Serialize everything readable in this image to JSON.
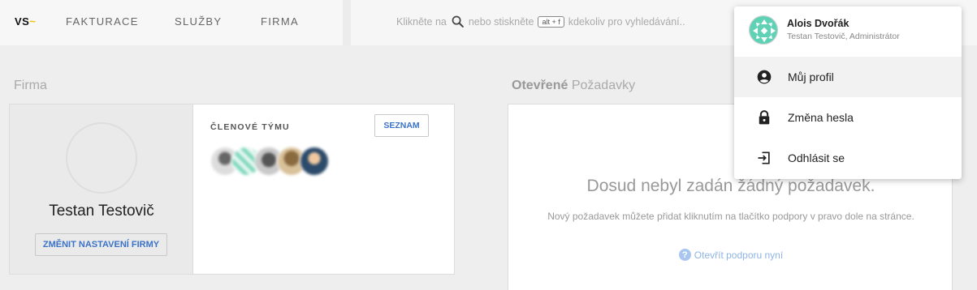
{
  "nav": {
    "logo_text": "VS",
    "logo_accent": "~",
    "items": [
      {
        "label": "FAKTURACE"
      },
      {
        "label": "SLUŽBY"
      },
      {
        "label": "FIRMA"
      }
    ]
  },
  "search": {
    "hint_before": "Klikněte na",
    "hint_middle": "nebo stiskněte",
    "shortcut": "alt + f",
    "hint_after": "kdekoliv pro vyhledávání.."
  },
  "firm": {
    "section_title": "Firma",
    "name": "Testan Testovič",
    "settings_button": "ZMĚNIT NASTAVENÍ FIRMY",
    "team_label": "ČLENOVÉ TÝMU",
    "list_button": "SEZNAM"
  },
  "requests": {
    "title_bold": "Otevřené",
    "title_rest": "Požadavky",
    "empty_title": "Dosud nebyl zadán žádný požadavek.",
    "empty_subtitle": "Nový požadavek můžete přidat kliknutím na tlačítko podpory v pravo dole na stránce.",
    "support_link": "Otevřít podporu nyní"
  },
  "user_menu": {
    "name": "Alois Dvořák",
    "company": "Testan Testovič",
    "role": ", Administrátor",
    "items": [
      {
        "label": "Můj profil",
        "icon": "account-circle-icon"
      },
      {
        "label": "Změna hesla",
        "icon": "lock-icon"
      },
      {
        "label": "Odhlásit se",
        "icon": "logout-icon"
      }
    ]
  },
  "colors": {
    "accent": "#3b73c8",
    "logo_accent": "#f2c200",
    "link_muted": "#8fb4e6"
  }
}
